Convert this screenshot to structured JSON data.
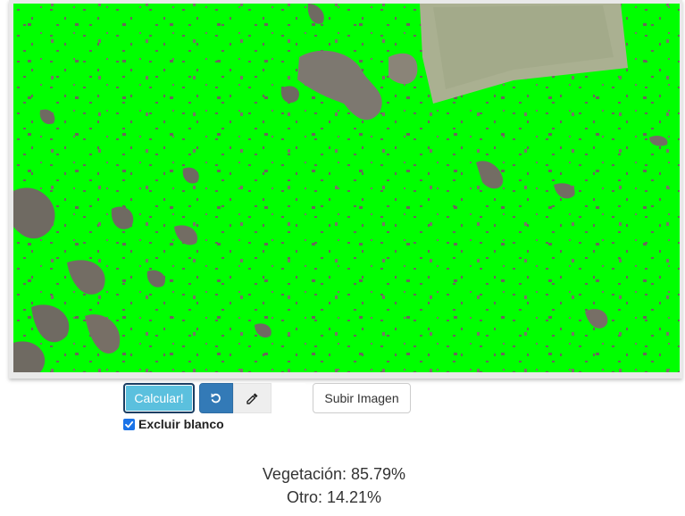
{
  "image": {
    "description_colors": {
      "vegetation": "#00ff00",
      "other": "#7a7268",
      "field": "#aab091",
      "frame": "#e9e9e9"
    }
  },
  "toolbar": {
    "calculate_label": "Calcular!",
    "reset_icon": "rotate-ccw-icon",
    "picker_icon": "eyedropper-icon",
    "selected_color": "#ffffff",
    "upload_label": "Subir Imagen"
  },
  "options": {
    "exclude_white_label": "Excluir blanco",
    "exclude_white_checked": true
  },
  "results": {
    "vegetation": "Vegetación: 85.79%",
    "other": "Otro: 14.21%"
  },
  "colors": {
    "calc_button": "#5bc0de",
    "reset_button": "#337ab7",
    "checkbox_accent": "#1a73e8"
  }
}
